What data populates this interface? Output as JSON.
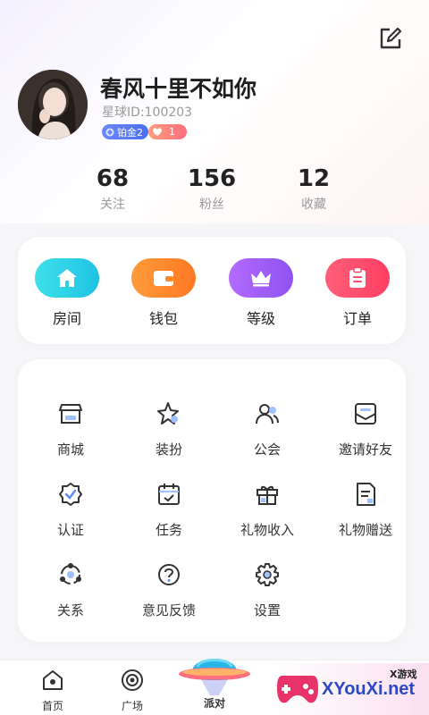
{
  "profile": {
    "nickname": "春风十里不如你",
    "star_id": "星球ID:100203",
    "badge_level": "铂金2",
    "badge_heart_count": "1"
  },
  "stats": [
    {
      "value": "68",
      "label": "关注"
    },
    {
      "value": "156",
      "label": "粉丝"
    },
    {
      "value": "12",
      "label": "收藏"
    }
  ],
  "quick_actions": [
    {
      "label": "房间",
      "icon": "home-icon",
      "color": "#27d2e6"
    },
    {
      "label": "钱包",
      "icon": "wallet-icon",
      "color": "#ff8a2b"
    },
    {
      "label": "等级",
      "icon": "crown-icon",
      "color": "#a25cf5"
    },
    {
      "label": "订单",
      "icon": "clipboard-icon",
      "color": "#ff4f6d"
    }
  ],
  "tools": [
    {
      "label": "商城",
      "icon": "shop-icon"
    },
    {
      "label": "装扮",
      "icon": "sparkle-star-icon"
    },
    {
      "label": "公会",
      "icon": "users-icon"
    },
    {
      "label": "邀请好友",
      "icon": "invite-envelope-icon"
    },
    {
      "label": "认证",
      "icon": "verified-badge-icon"
    },
    {
      "label": "任务",
      "icon": "calendar-check-icon"
    },
    {
      "label": "礼物收入",
      "icon": "gift-icon"
    },
    {
      "label": "礼物赠送",
      "icon": "gift-note-icon"
    },
    {
      "label": "关系",
      "icon": "relation-orbit-icon"
    },
    {
      "label": "意见反馈",
      "icon": "question-icon"
    },
    {
      "label": "设置",
      "icon": "settings-gear-icon"
    }
  ],
  "nav": {
    "home": "首页",
    "plaza": "广场",
    "party": "派对"
  },
  "watermark": {
    "brand": "XYouXi.net",
    "small": "X游戏"
  }
}
